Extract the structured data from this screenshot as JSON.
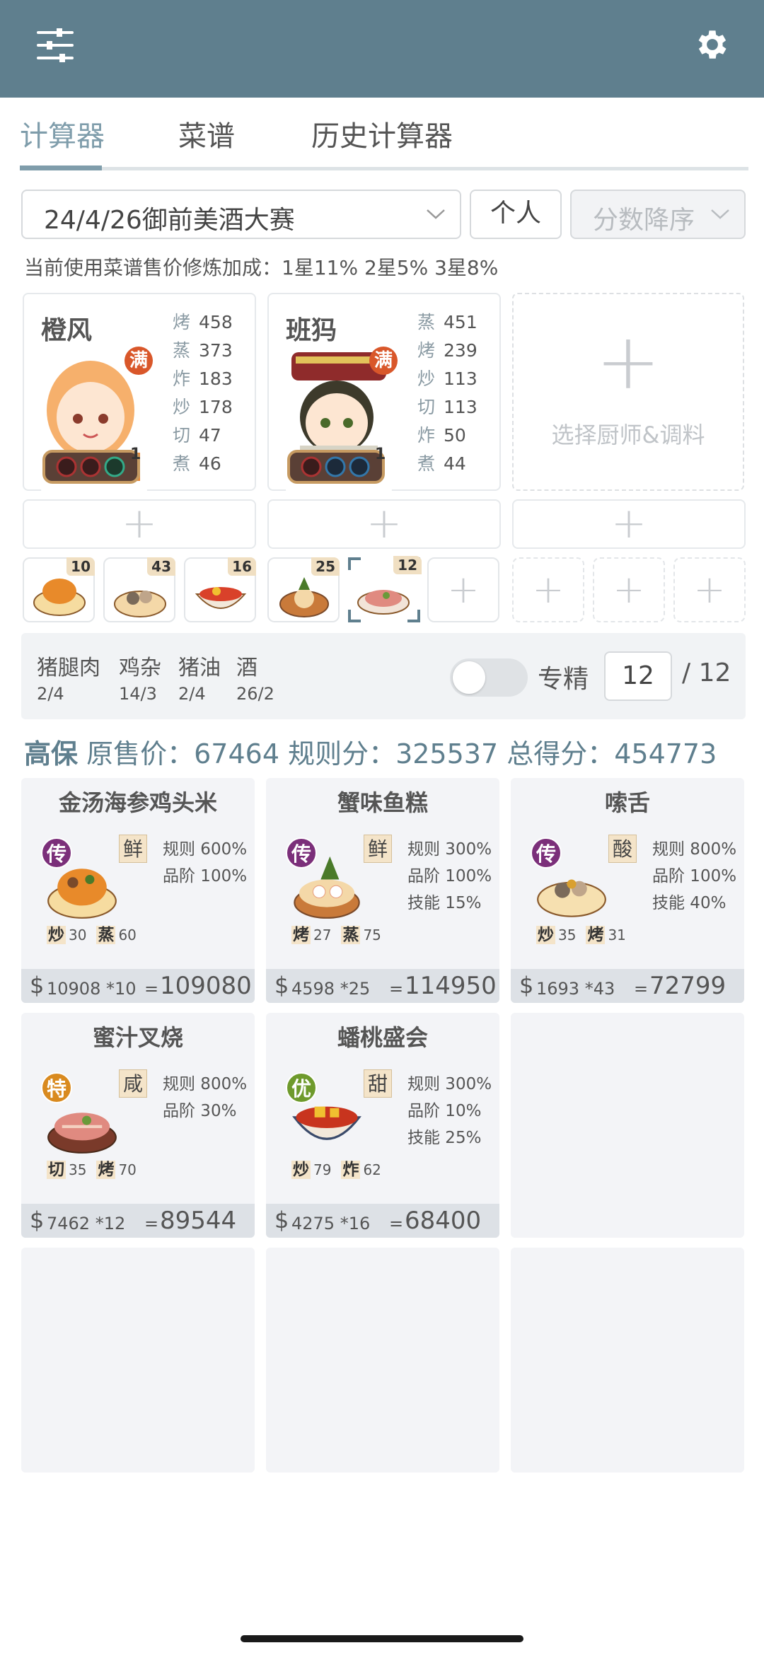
{
  "header": {
    "menu_icon": "sliders-icon",
    "settings_icon": "gear-icon"
  },
  "tabs": [
    {
      "label": "计算器"
    },
    {
      "label": "菜谱"
    },
    {
      "label": "历史计算器"
    }
  ],
  "filters": {
    "event": "24/4/26御前美酒大赛",
    "mode": "个人",
    "sort": "分数降序"
  },
  "bonus_text": "当前使用菜谱售价修炼加成：1星11% 2星5% 3星8%",
  "chefs": [
    {
      "name": "橙风",
      "badge": "满",
      "level": "1",
      "stats": [
        {
          "k": "烤",
          "v": "458"
        },
        {
          "k": "蒸",
          "v": "373"
        },
        {
          "k": "炸",
          "v": "183"
        },
        {
          "k": "炒",
          "v": "178"
        },
        {
          "k": "切",
          "v": "47"
        },
        {
          "k": "煮",
          "v": "46"
        }
      ]
    },
    {
      "name": "班犸",
      "badge": "满",
      "level": "1",
      "stats": [
        {
          "k": "蒸",
          "v": "451"
        },
        {
          "k": "烤",
          "v": "239"
        },
        {
          "k": "炒",
          "v": "113"
        },
        {
          "k": "切",
          "v": "113"
        },
        {
          "k": "炸",
          "v": "50"
        },
        {
          "k": "煮",
          "v": "44"
        }
      ]
    }
  ],
  "add_chef_label": "选择厨师&调料",
  "recipe_slots": [
    "10",
    "43",
    "16",
    "25",
    "12"
  ],
  "ingredients": [
    {
      "name": "猪腿肉",
      "qty": "2/4"
    },
    {
      "name": "鸡杂",
      "qty": "14/3"
    },
    {
      "name": "猪油",
      "qty": "2/4"
    },
    {
      "name": "酒",
      "qty": "26/2"
    }
  ],
  "specialty": {
    "label": "专精",
    "value": "12",
    "total": "/ 12"
  },
  "summary": {
    "level": "高保",
    "text": "原售价：67464 规则分：325537 总得分：454773"
  },
  "recipes": [
    {
      "name": "金汤海参鸡头米",
      "rank": "传",
      "rank_color": "#7b2f7a",
      "flavor": "鲜",
      "stats": [
        "规则 600%",
        "品阶 100%"
      ],
      "skills": [
        {
          "k": "炒",
          "v": "30"
        },
        {
          "k": "蒸",
          "v": "60"
        }
      ],
      "price": "10908 *10",
      "eq": "=",
      "total": "109080"
    },
    {
      "name": "蟹味鱼糕",
      "rank": "传",
      "rank_color": "#7b2f7a",
      "flavor": "鲜",
      "stats": [
        "规则 300%",
        "品阶 100%",
        "技能 15%"
      ],
      "skills": [
        {
          "k": "烤",
          "v": "27"
        },
        {
          "k": "蒸",
          "v": "75"
        }
      ],
      "price": "4598 *25",
      "eq": "=",
      "total": "114950"
    },
    {
      "name": "嗦舌",
      "rank": "传",
      "rank_color": "#7b2f7a",
      "flavor": "酸",
      "stats": [
        "规则 800%",
        "品阶 100%",
        "技能 40%"
      ],
      "skills": [
        {
          "k": "炒",
          "v": "35"
        },
        {
          "k": "烤",
          "v": "31"
        }
      ],
      "price": "1693 *43",
      "eq": "=",
      "total": "72799"
    },
    {
      "name": "蜜汁叉烧",
      "rank": "特",
      "rank_color": "#d98a1f",
      "flavor": "咸",
      "stats": [
        "规则 800%",
        "品阶 30%"
      ],
      "skills": [
        {
          "k": "切",
          "v": "35"
        },
        {
          "k": "烤",
          "v": "70"
        }
      ],
      "price": "7462 *12",
      "eq": "=",
      "total": "89544"
    },
    {
      "name": "蟠桃盛会",
      "rank": "优",
      "rank_color": "#6e9a2c",
      "flavor": "甜",
      "stats": [
        "规则 300%",
        "品阶 10%",
        "技能 25%"
      ],
      "skills": [
        {
          "k": "炒",
          "v": "79"
        },
        {
          "k": "炸",
          "v": "62"
        }
      ],
      "price": "4275 *16",
      "eq": "=",
      "total": "68400"
    }
  ]
}
